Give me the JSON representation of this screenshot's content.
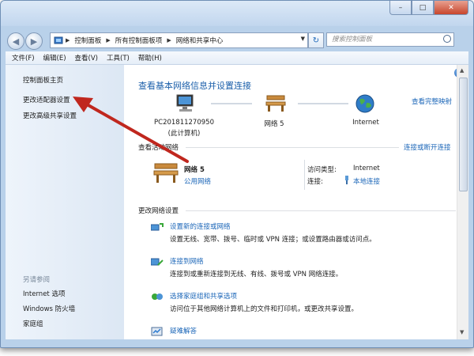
{
  "window": {
    "controls": {
      "minimize": "–",
      "maximize": "□",
      "close": "✕"
    }
  },
  "nav": {
    "back_glyph": "◀",
    "forward_glyph": "▶",
    "breadcrumb": [
      "控制面板",
      "所有控制面板项",
      "网络和共享中心"
    ],
    "search_placeholder": "搜索控制面板"
  },
  "menu": [
    "文件(F)",
    "编辑(E)",
    "查看(V)",
    "工具(T)",
    "帮助(H)"
  ],
  "sidebar": {
    "links": [
      "控制面板主页",
      "更改适配器设置",
      "更改高级共享设置"
    ],
    "see_also_heading": "另请参阅",
    "see_also": [
      "Internet 选项",
      "Windows 防火墙",
      "家庭组"
    ]
  },
  "main": {
    "title": "查看基本网络信息并设置连接",
    "full_map": "查看完整映射",
    "map": {
      "computer_name": "PC201811270950",
      "computer_sub": "(此计算机)",
      "network": "网络  5",
      "internet": "Internet"
    },
    "active": {
      "heading": "查看活动网络",
      "link": "连接或断开连接",
      "name": "网络  5",
      "type": "公用网络",
      "access_label": "访问类型:",
      "access_value": "Internet",
      "conn_label": "连接:",
      "conn_value": "本地连接"
    },
    "change": {
      "heading": "更改网络设置",
      "tasks": [
        {
          "link": "设置新的连接或网络",
          "desc": "设置无线、宽带、拨号、临时或 VPN 连接；或设置路由器或访问点。"
        },
        {
          "link": "连接到网络",
          "desc": "连接到或重新连接到无线、有线、拨号或 VPN 网络连接。"
        },
        {
          "link": "选择家庭组和共享选项",
          "desc": "访问位于其他网络计算机上的文件和打印机，或更改共享设置。"
        },
        {
          "link": "疑难解答",
          "desc": ""
        }
      ]
    },
    "help_glyph": "?"
  },
  "colors": {
    "link": "#1b66b8",
    "annotation_arrow": "#c0271e"
  }
}
